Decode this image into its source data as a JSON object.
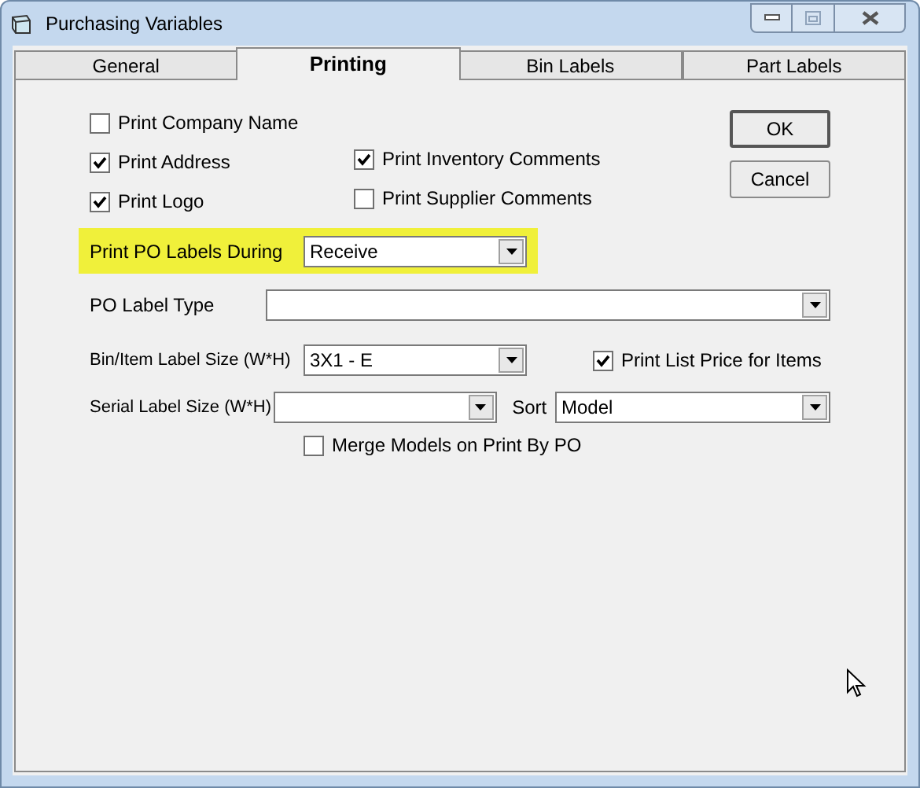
{
  "window": {
    "title": "Purchasing Variables"
  },
  "tabs": [
    {
      "label": "General",
      "selected": false
    },
    {
      "label": "Printing",
      "selected": true
    },
    {
      "label": "Bin Labels",
      "selected": false
    },
    {
      "label": "Part Labels",
      "selected": false
    }
  ],
  "left_options": [
    {
      "label": "Print Company Name",
      "checked": false
    },
    {
      "label": "Print Address",
      "checked": true
    },
    {
      "label": "Print Logo",
      "checked": true
    }
  ],
  "right_options": [
    {
      "label": "Print Inventory Comments",
      "checked": true
    },
    {
      "label": "Print Supplier Comments",
      "checked": false
    }
  ],
  "buttons": [
    {
      "label": "OK",
      "default": true
    },
    {
      "label": "Cancel",
      "default": false
    }
  ],
  "print_po_labels_during": {
    "label": "Print PO Labels During",
    "value": "Receive",
    "highlighted": true
  },
  "po_label_type": {
    "label": "PO Label Type"
  },
  "bin_item_label_size": {
    "label": "Bin/Item Label Size  (W*H)",
    "value": "3X1 - E"
  },
  "print_list_price": {
    "label": "Print List Price for Items",
    "checked": true
  },
  "serial_label_size": {
    "label": "Serial Label Size  (W*H)"
  },
  "sort": {
    "label": "Sort",
    "value": "Model"
  },
  "merge_models": {
    "label": "Merge Models on Print By PO",
    "checked": false
  }
}
